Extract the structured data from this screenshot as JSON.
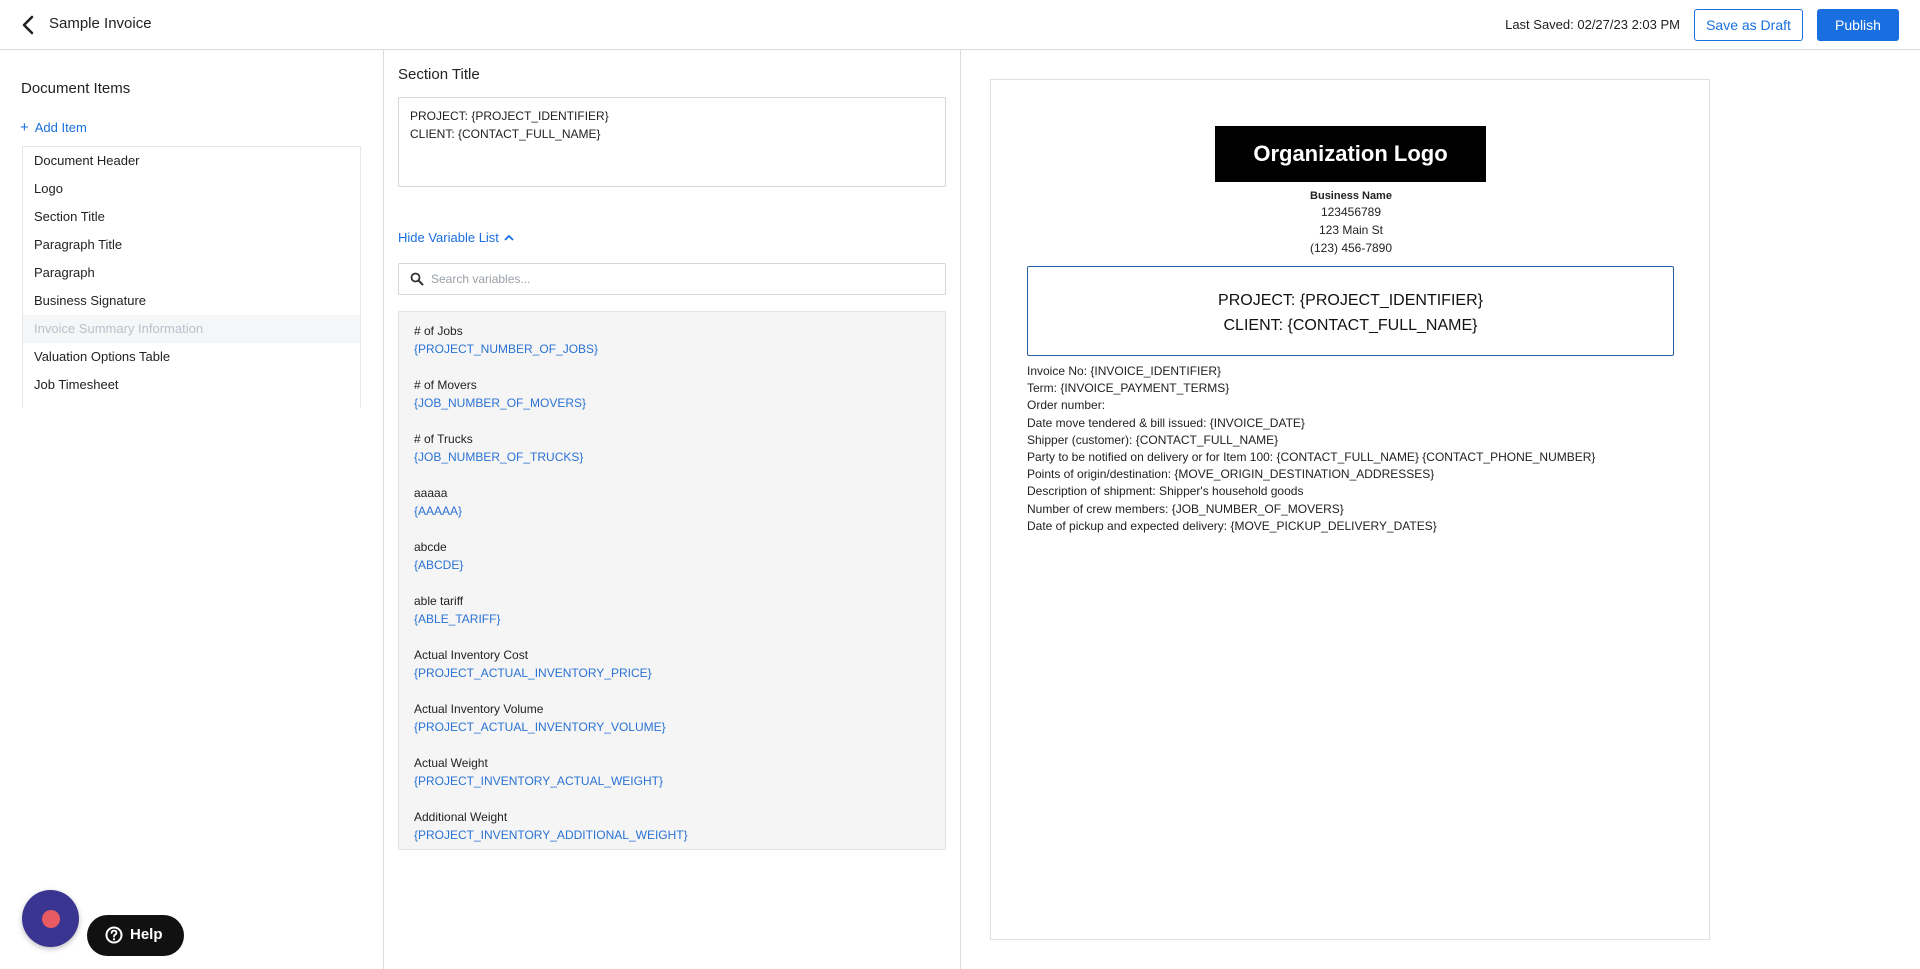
{
  "header": {
    "title": "Sample Invoice",
    "last_saved": "Last Saved: 02/27/23 2:03 PM",
    "save_draft_label": "Save as Draft",
    "publish_label": "Publish"
  },
  "left_panel": {
    "heading": "Document Items",
    "add_item_label": "Add Item",
    "items": [
      {
        "label": "Document Header"
      },
      {
        "label": "Logo"
      },
      {
        "label": "Section Title"
      },
      {
        "label": "Paragraph Title"
      },
      {
        "label": "Paragraph"
      },
      {
        "label": "Business Signature"
      },
      {
        "label": "Invoice Summary Information"
      },
      {
        "label": "Valuation Options Table"
      },
      {
        "label": "Job Timesheet"
      }
    ]
  },
  "editor": {
    "heading": "Section Title",
    "content_lines": [
      "PROJECT: {PROJECT_IDENTIFIER}",
      "CLIENT: {CONTACT_FULL_NAME}"
    ],
    "hide_variables_label": "Hide Variable List",
    "search_placeholder": "Search variables...",
    "variables": [
      {
        "label": "# of Jobs",
        "token": "{PROJECT_NUMBER_OF_JOBS}"
      },
      {
        "label": "# of Movers",
        "token": "{JOB_NUMBER_OF_MOVERS}"
      },
      {
        "label": "# of Trucks",
        "token": "{JOB_NUMBER_OF_TRUCKS}"
      },
      {
        "label": "aaaaa",
        "token": "{AAAAA}"
      },
      {
        "label": "abcde",
        "token": "{ABCDE}"
      },
      {
        "label": "able tariff",
        "token": "{ABLE_TARIFF}"
      },
      {
        "label": "Actual Inventory Cost",
        "token": "{PROJECT_ACTUAL_INVENTORY_PRICE}"
      },
      {
        "label": "Actual Inventory Volume",
        "token": "{PROJECT_ACTUAL_INVENTORY_VOLUME}"
      },
      {
        "label": "Actual Weight",
        "token": "{PROJECT_INVENTORY_ACTUAL_WEIGHT}"
      },
      {
        "label": "Additional Weight",
        "token": "{PROJECT_INVENTORY_ADDITIONAL_WEIGHT}"
      }
    ]
  },
  "preview": {
    "logo_text": "Organization Logo",
    "business_name": "Business Name",
    "business_id": "123456789",
    "address": "123 Main St",
    "phone": "(123) 456-7890",
    "section_lines": [
      "PROJECT: {PROJECT_IDENTIFIER}",
      "CLIENT: {CONTACT_FULL_NAME}"
    ],
    "info_lines": [
      "Invoice No: {INVOICE_IDENTIFIER}",
      "Term: {INVOICE_PAYMENT_TERMS}",
      "Order number:",
      "Date move tendered & bill issued: {INVOICE_DATE}",
      "Shipper (customer): {CONTACT_FULL_NAME}",
      "Party to be notified on delivery or for Item 100: {CONTACT_FULL_NAME} {CONTACT_PHONE_NUMBER}",
      "Points of origin/destination: {MOVE_ORIGIN_DESTINATION_ADDRESSES}",
      "Description of shipment: Shipper's household goods",
      "Number of crew members: {JOB_NUMBER_OF_MOVERS}",
      "Date of pickup and expected delivery: {MOVE_PICKUP_DELIVERY_DATES}"
    ]
  },
  "floating": {
    "help_label": "Help"
  },
  "colors": {
    "accent": "#1a6fe0",
    "variable_token": "#2a72d4",
    "chat_bubble": "#3a3590",
    "chat_dot": "#e85b63"
  }
}
